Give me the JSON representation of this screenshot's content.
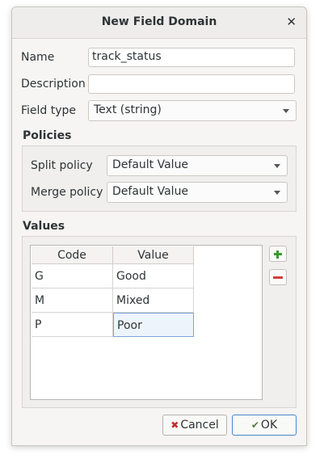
{
  "dialog": {
    "title": "New Field Domain",
    "close_label": "✕"
  },
  "form": {
    "name_label": "Name",
    "name_value": "track_status",
    "description_label": "Description",
    "description_value": "",
    "field_type_label": "Field type",
    "field_type_value": "Text (string)"
  },
  "policies": {
    "title": "Policies",
    "split_label": "Split policy",
    "split_value": "Default Value",
    "merge_label": "Merge policy",
    "merge_value": "Default Value"
  },
  "values": {
    "title": "Values",
    "columns": [
      "Code",
      "Value"
    ],
    "rows": [
      {
        "code": "G",
        "value": "Good"
      },
      {
        "code": "M",
        "value": "Mixed"
      },
      {
        "code": "P",
        "value": "Poor"
      }
    ]
  },
  "buttons": {
    "cancel": "Cancel",
    "ok": "OK"
  },
  "icons": {
    "add": "plus-icon",
    "remove": "minus-icon",
    "cancel": "cancel-icon",
    "ok": "ok-icon"
  },
  "colors": {
    "accent": "#4a86c8",
    "add_icon": "#3a9a2f",
    "remove_icon": "#d0403a"
  }
}
